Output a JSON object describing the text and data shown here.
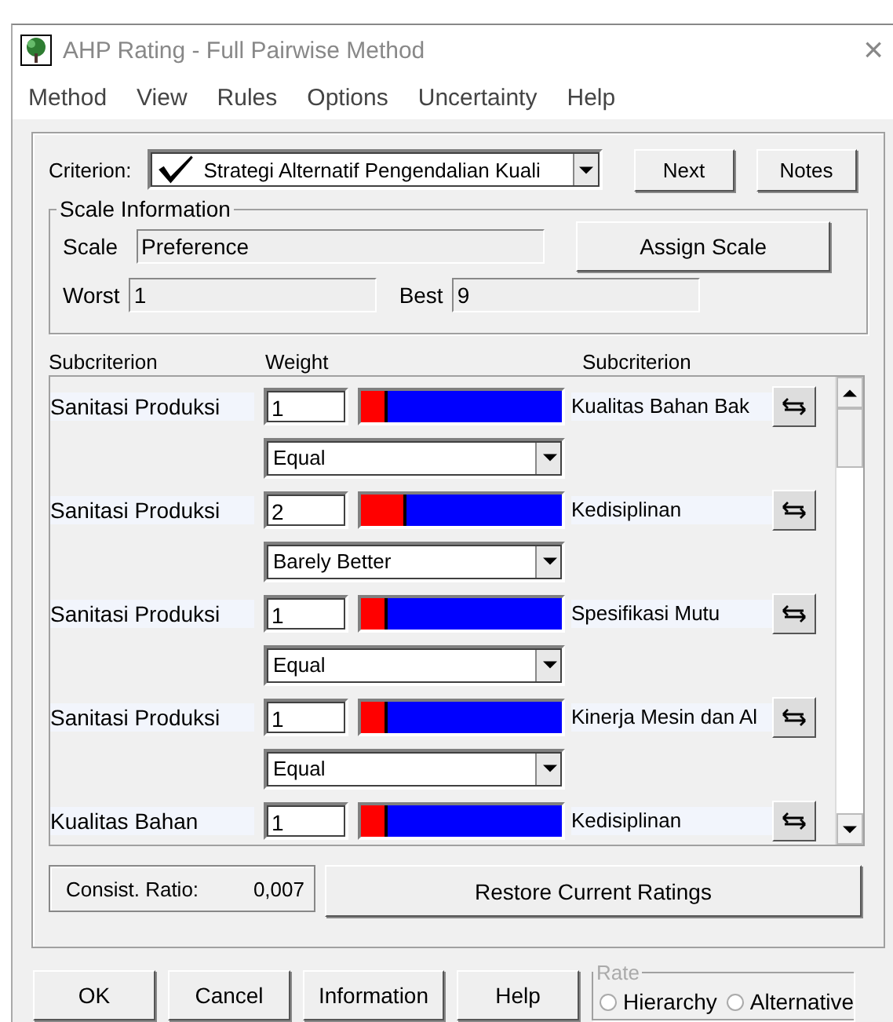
{
  "window": {
    "title": "AHP Rating - Full Pairwise Method",
    "close": "×"
  },
  "menu": [
    "Method",
    "View",
    "Rules",
    "Options",
    "Uncertainty",
    "Help"
  ],
  "criterion": {
    "label": "Criterion:",
    "value": "Strategi Alternatif Pengendalian Kuali",
    "checked": true
  },
  "top_buttons": [
    {
      "label": "Next"
    },
    {
      "label": "Notes"
    }
  ],
  "scale_info": {
    "title": "Scale Information",
    "scale_label": "Scale",
    "scale": "Preference",
    "assign": {
      "label": "Assign Scale"
    },
    "worst_label": "Worst",
    "worst": "1",
    "best_label": "Best",
    "best": "9"
  },
  "columns": [
    "Subcriterion",
    "Weight",
    "Subcriterion"
  ],
  "comparisons": [
    {
      "left": "Sanitasi Produksi",
      "value": "1",
      "level": 0.13,
      "verbal": "Equal",
      "right": "Kualitas Bahan Bak"
    },
    {
      "left": "Sanitasi Produksi",
      "value": "2",
      "level": 0.23,
      "verbal": "Barely Better",
      "right": "Kedisiplinan"
    },
    {
      "left": "Sanitasi Produksi",
      "value": "1",
      "level": 0.13,
      "verbal": "Equal",
      "right": "Spesifikasi Mutu"
    },
    {
      "left": "Sanitasi Produksi",
      "value": "1",
      "level": 0.13,
      "verbal": "Equal",
      "right": "Kinerja Mesin dan Al"
    },
    {
      "left": "Kualitas Bahan",
      "value": "1",
      "level": 0.13,
      "right": "Kedisiplinan"
    }
  ],
  "consistency": {
    "label": "Consist. Ratio:",
    "value": "0,007"
  },
  "restore": {
    "label": "Restore Current Ratings"
  },
  "bottom_buttons": [
    {
      "label": "OK"
    },
    {
      "label": "Cancel"
    },
    {
      "label": "Information"
    },
    {
      "label": "Help"
    }
  ],
  "rate": {
    "title": "Rate",
    "options": [
      {
        "label": "Hierarchy",
        "selected": false
      },
      {
        "label": "Alternative",
        "selected": false
      }
    ]
  }
}
